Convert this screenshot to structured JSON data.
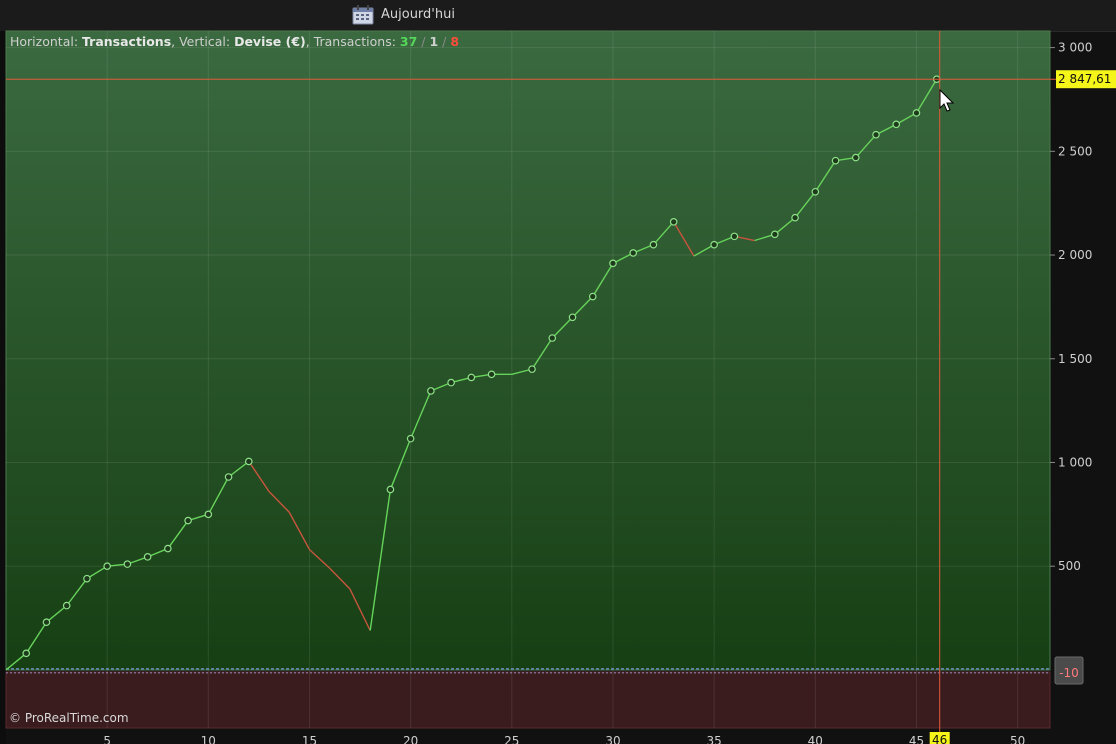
{
  "toolbar": {
    "calendar_icon": "calendar-icon",
    "today_label": "Aujourd'hui"
  },
  "info": {
    "h_label": "Horizontal: ",
    "h_value": "Transactions",
    "v_label": ", Vertical: ",
    "v_value": "Devise (€)",
    "t_label": ", Transactions: ",
    "win": "37",
    "sep1": " / ",
    "neutral": "1",
    "sep2": " / ",
    "loss": "8"
  },
  "watermark": "© ProRealTime.com",
  "crosshair": {
    "y_value_label": "2 847,61",
    "x_value_label": "46"
  },
  "zero_badge": "-10",
  "colors": {
    "gain": "#66d35a",
    "loss": "#c8553d",
    "crosshair": "#e05a3a",
    "badge": "#f5f51a"
  },
  "chart_data": {
    "type": "line",
    "title": "",
    "xlabel": "",
    "ylabel": "",
    "xlim": [
      0,
      51.6
    ],
    "ylim": [
      -280,
      3080
    ],
    "x_ticks": [
      5,
      10,
      15,
      20,
      25,
      30,
      35,
      40,
      45,
      50
    ],
    "x_tick_labels": [
      "5",
      "10",
      "15",
      "20",
      "25",
      "30",
      "35",
      "40",
      "45",
      "50"
    ],
    "y_ticks": [
      500,
      1000,
      1500,
      2000,
      2500,
      3000
    ],
    "y_tick_labels": [
      "500",
      "1 000",
      "1 500",
      "2 000",
      "2 500",
      "3 000"
    ],
    "series": [
      {
        "x": [
          0,
          1,
          2,
          3,
          4,
          5,
          6,
          7,
          8,
          9,
          10,
          11,
          12,
          13,
          14,
          15,
          16,
          17,
          18,
          19,
          20,
          21,
          22,
          23,
          24,
          25,
          26,
          27,
          28,
          29,
          30,
          31,
          32,
          33,
          34,
          35,
          36,
          37,
          38,
          39,
          40,
          41,
          42,
          43,
          44,
          45,
          46
        ],
        "values": [
          0,
          80,
          230,
          310,
          440,
          500,
          510,
          545,
          585,
          720,
          750,
          930,
          1005,
          860,
          760,
          580,
          490,
          390,
          190,
          870,
          1115,
          1345,
          1385,
          1410,
          1425,
          1425,
          1450,
          1600,
          1700,
          1800,
          1960,
          2010,
          2050,
          2160,
          1995,
          2050,
          2090,
          2070,
          2100,
          2180,
          2305,
          2455,
          2470,
          2580,
          2630,
          2685,
          2847.61
        ],
        "result": [
          "g",
          "g",
          "g",
          "g",
          "g",
          "g",
          "g",
          "g",
          "g",
          "g",
          "g",
          "g",
          "l",
          "l",
          "l",
          "l",
          "l",
          "l",
          "g",
          "g",
          "g",
          "g",
          "g",
          "g",
          "n",
          "g",
          "g",
          "g",
          "g",
          "g",
          "g",
          "g",
          "g",
          "l",
          "g",
          "g",
          "l",
          "g",
          "g",
          "g",
          "g",
          "g",
          "g",
          "g",
          "g",
          "g"
        ]
      }
    ]
  }
}
